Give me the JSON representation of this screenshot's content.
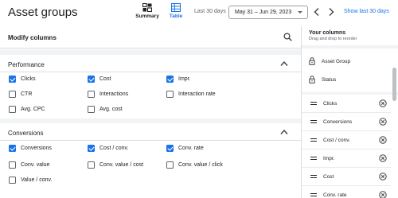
{
  "header": {
    "title": "Asset groups",
    "views": [
      {
        "label": "Summary",
        "icon": "summary-grid-icon",
        "active": false
      },
      {
        "label": "Table",
        "icon": "table-icon",
        "active": true
      }
    ],
    "range_label": "Last 30 days",
    "date_range": "May 31 – Jun 29, 2023",
    "show_last_label": "Show last 30 days",
    "accent": "#1a73e8"
  },
  "main": {
    "title": "Modify columns",
    "sections": [
      {
        "title": "Performance",
        "expanded": true,
        "items": [
          {
            "label": "Clicks",
            "checked": true
          },
          {
            "label": "Cost",
            "checked": true
          },
          {
            "label": "Impr.",
            "checked": true
          },
          {
            "label": "CTR",
            "checked": false
          },
          {
            "label": "Interactions",
            "checked": false
          },
          {
            "label": "Interaction rate",
            "checked": false
          },
          {
            "label": "Avg. CPC",
            "checked": false
          },
          {
            "label": "Avg. cost",
            "checked": false
          }
        ]
      },
      {
        "title": "Conversions",
        "expanded": true,
        "items": [
          {
            "label": "Conversions",
            "checked": true
          },
          {
            "label": "Cost / conv.",
            "checked": true
          },
          {
            "label": "Conv. rate",
            "checked": true
          },
          {
            "label": "Conv. value",
            "checked": false
          },
          {
            "label": "Conv. value / cost",
            "checked": false
          },
          {
            "label": "Conv. value / click",
            "checked": false
          },
          {
            "label": "Value / conv.",
            "checked": false
          }
        ]
      }
    ]
  },
  "your_columns": {
    "title": "Your columns",
    "subtitle": "Drag and drop to reorder",
    "fixed": [
      "Asset Group",
      "Status"
    ],
    "columns": [
      "Clicks",
      "Conversions",
      "Cost / conv.",
      "Impr.",
      "Cost",
      "Conv. rate"
    ]
  }
}
